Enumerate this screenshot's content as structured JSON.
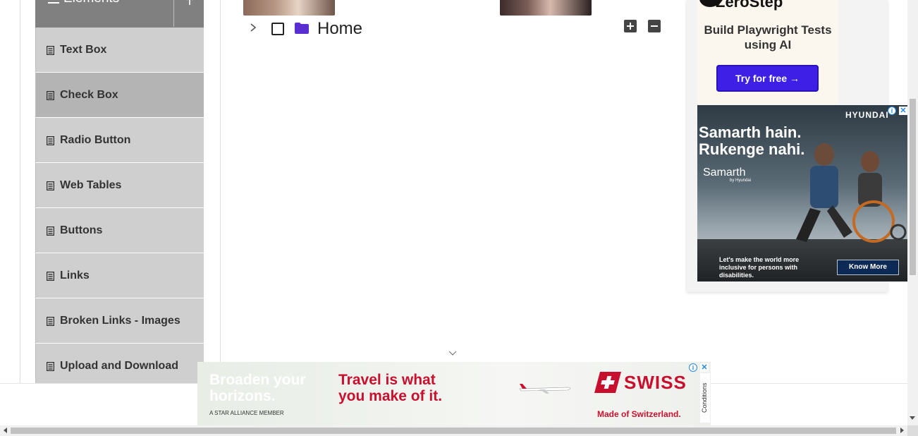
{
  "sidebar": {
    "group_title": "Elements",
    "items": [
      {
        "label": "Text Box",
        "active": false
      },
      {
        "label": "Check Box",
        "active": true
      },
      {
        "label": "Radio Button",
        "active": false
      },
      {
        "label": "Web Tables",
        "active": false
      },
      {
        "label": "Buttons",
        "active": false
      },
      {
        "label": "Links",
        "active": false
      },
      {
        "label": "Broken Links - Images",
        "active": false
      },
      {
        "label": "Upload and Download",
        "active": false
      }
    ]
  },
  "tree": {
    "root_label": "Home",
    "checked": false,
    "expanded": false,
    "folder_color": "#5a2fd1"
  },
  "ads": {
    "zerostep": {
      "brand": "ZeroStep",
      "title": "Build Playwright Tests using AI",
      "cta": "Try for free →"
    },
    "hyundai": {
      "brand": "HYUNDAI",
      "headline": "Samarth hain. Rukenge nahi.",
      "program": "Samarth",
      "program_sub": "by Hyundai",
      "tagline": "Let's make the world more inclusive for persons with disabilities.",
      "cta": "Know More"
    },
    "swiss": {
      "line1": "Broaden your horizons.",
      "alliance": "A STAR ALLIANCE MEMBER",
      "headline": "Travel is what you make of it.",
      "brand": "SWISS",
      "tagline": "Made of Switzerland.",
      "conditions": "Conditions"
    }
  },
  "colors": {
    "accent": "#3d1fe6",
    "swiss_red": "#c8102e",
    "sidebar_active": "#b4b4b4",
    "sidebar_item": "#cfcfcf"
  }
}
